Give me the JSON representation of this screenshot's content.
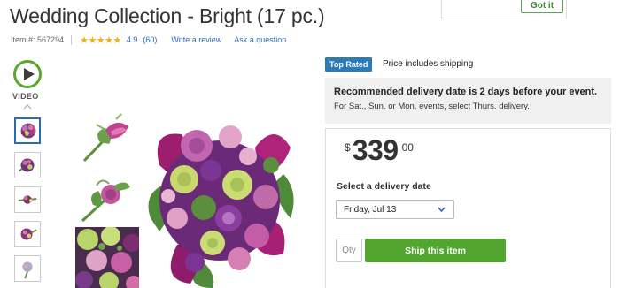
{
  "product": {
    "title": "Wedding Collection - Bright (17 pc.)",
    "item_label": "Item #:",
    "item_number": "567294",
    "stars": "★★★★★",
    "rating": "4.9",
    "review_count": "(60)",
    "write_review": "Write a review",
    "ask_question": "Ask a question"
  },
  "notice": {
    "got_it": "Got it"
  },
  "gallery": {
    "video_label": "VIDEO",
    "thumbnails": [
      "bouquet",
      "boutonniere",
      "corsage",
      "wrist-corsage",
      "pin-corsage"
    ],
    "active_index": 0
  },
  "offer": {
    "badge": "Top Rated",
    "shipping_note": "Price includes shipping",
    "delivery_title": "Recommended delivery date is 2 days before your event.",
    "delivery_note": "For Sat., Sun. or Mon. events, select Thurs. delivery.",
    "currency": "$",
    "price_dollars": "339",
    "price_cents": "00",
    "date_label": "Select a delivery date",
    "date_value": "Friday, Jul 13",
    "qty_placeholder": "Qty",
    "ship_button": "Ship this item"
  },
  "colors": {
    "accent_green": "#52a62f",
    "link_blue": "#2d6ab4",
    "badge_blue": "#2b7bb9",
    "star_gold": "#f2b01e"
  }
}
